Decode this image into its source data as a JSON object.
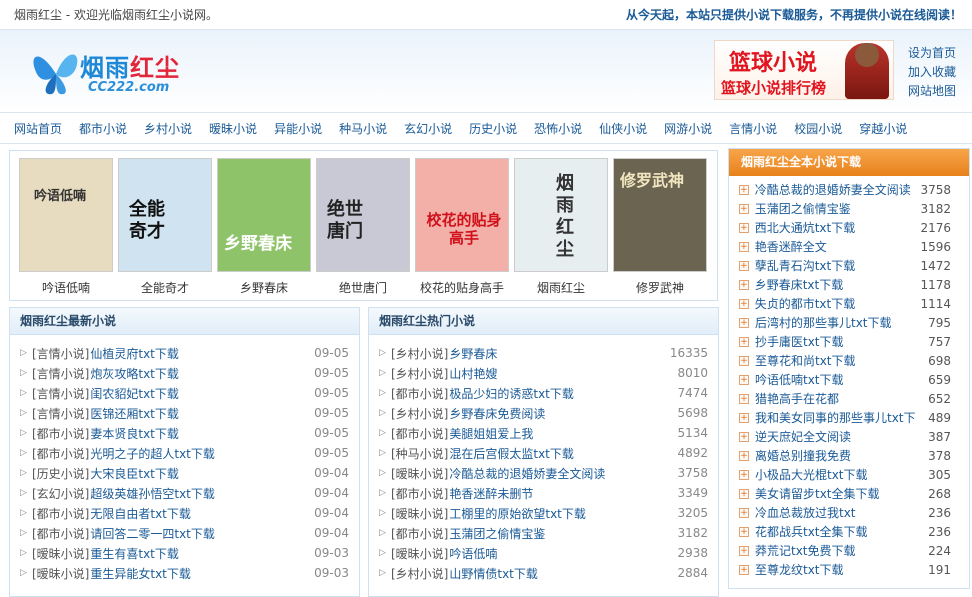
{
  "topbar": {
    "welcome": "烟雨红尘 - 欢迎光临烟雨红尘小说网。",
    "notice": "从今天起，本站只提供小说下载服务，不再提供小说在线阅读！"
  },
  "logo": {
    "title_blue": "烟雨",
    "title_red": "红尘",
    "domain": "CC222.com"
  },
  "banner": {
    "title": "篮球小说",
    "subtitle": "篮球小说排行榜"
  },
  "header_links": [
    "设为首页",
    "加入收藏",
    "网站地图"
  ],
  "nav": [
    "网站首页",
    "都市小说",
    "乡村小说",
    "暧昧小说",
    "异能小说",
    "种马小说",
    "玄幻小说",
    "历史小说",
    "恐怖小说",
    "仙侠小说",
    "网游小说",
    "言情小说",
    "校园小说",
    "穿越小说"
  ],
  "covers": [
    {
      "name": "吟语低喃",
      "cover_text": "吟语低喃",
      "bg": "#e8dcc0",
      "fg": "#333333"
    },
    {
      "name": "全能奇才",
      "cover_text": "全能奇才",
      "bg": "#cfe3f0",
      "fg": "#111111"
    },
    {
      "name": "乡野春床",
      "cover_text": "乡野春床",
      "bg": "#8fc36a",
      "fg": "#ffffff"
    },
    {
      "name": "绝世唐门",
      "cover_text": "绝世唐门",
      "bg": "#c9c9d6",
      "fg": "#222222"
    },
    {
      "name": "校花的贴身高手",
      "cover_text": "校花的贴身高手",
      "bg": "#f2b0a8",
      "fg": "#d0101a"
    },
    {
      "name": "烟雨红尘",
      "cover_text": "烟雨红尘",
      "bg": "#e6eef0",
      "fg": "#333333"
    },
    {
      "name": "修罗武神",
      "cover_text": "修罗武神",
      "bg": "#6b6450",
      "fg": "#f0e6c0"
    }
  ],
  "latest": {
    "heading": "烟雨红尘最新小说",
    "rows": [
      {
        "cat": "[言情小说]",
        "title": "仙植灵府txt下载",
        "val": "09-05"
      },
      {
        "cat": "[言情小说]",
        "title": "炮灰攻略txt下载",
        "val": "09-05"
      },
      {
        "cat": "[言情小说]",
        "title": "闺农貂妃txt下载",
        "val": "09-05"
      },
      {
        "cat": "[言情小说]",
        "title": "医锦还厢txt下载",
        "val": "09-05"
      },
      {
        "cat": "[都市小说]",
        "title": "妻本贤良txt下载",
        "val": "09-05"
      },
      {
        "cat": "[都市小说]",
        "title": "光明之子的超人txt下载",
        "val": "09-05"
      },
      {
        "cat": "[历史小说]",
        "title": "大宋良臣txt下载",
        "val": "09-04"
      },
      {
        "cat": "[玄幻小说]",
        "title": "超级英雄孙悟空txt下载",
        "val": "09-04"
      },
      {
        "cat": "[都市小说]",
        "title": "无限自由者txt下载",
        "val": "09-04"
      },
      {
        "cat": "[都市小说]",
        "title": "请回答二零一四txt下载",
        "val": "09-04"
      },
      {
        "cat": "[暧昧小说]",
        "title": "重生有喜txt下载",
        "val": "09-03"
      },
      {
        "cat": "[暧昧小说]",
        "title": "重生异能女txt下载",
        "val": "09-03"
      }
    ]
  },
  "hot": {
    "heading": "烟雨红尘热门小说",
    "rows": [
      {
        "cat": "[乡村小说]",
        "title": "乡野春床",
        "val": "16335"
      },
      {
        "cat": "[乡村小说]",
        "title": "山村艳嫂",
        "val": "8010"
      },
      {
        "cat": "[都市小说]",
        "title": "极品少妇的诱惑txt下载",
        "val": "7474"
      },
      {
        "cat": "[乡村小说]",
        "title": "乡野春床免费阅读",
        "val": "5698"
      },
      {
        "cat": "[都市小说]",
        "title": "美腿姐姐爱上我",
        "val": "5134"
      },
      {
        "cat": "[种马小说]",
        "title": "混在后宫假太监txt下载",
        "val": "4892"
      },
      {
        "cat": "[暧昧小说]",
        "title": "冷酷总裁的退婚娇妻全文阅读",
        "val": "3758"
      },
      {
        "cat": "[都市小说]",
        "title": "艳香迷醉未删节",
        "val": "3349"
      },
      {
        "cat": "[暧昧小说]",
        "title": "工棚里的原始欲望txt下载",
        "val": "3205"
      },
      {
        "cat": "[都市小说]",
        "title": "玉蒲团之偷情宝鉴",
        "val": "3182"
      },
      {
        "cat": "[暧昧小说]",
        "title": "吟语低喃",
        "val": "2938"
      },
      {
        "cat": "[乡村小说]",
        "title": "山野情债txt下载",
        "val": "2884"
      }
    ]
  },
  "sidebar": {
    "heading": "烟雨红尘全本小说下载",
    "rows": [
      {
        "title": "冷酷总裁的退婚娇妻全文阅读",
        "val": "3758"
      },
      {
        "title": "玉蒲团之偷情宝鉴",
        "val": "3182"
      },
      {
        "title": "西北大通炕txt下载",
        "val": "2176"
      },
      {
        "title": "艳香迷醉全文",
        "val": "1596"
      },
      {
        "title": "孽乱青石沟txt下载",
        "val": "1472"
      },
      {
        "title": "乡野春床txt下载",
        "val": "1178"
      },
      {
        "title": "失贞的都市txt下载",
        "val": "1114"
      },
      {
        "title": "后湾村的那些事儿txt下载",
        "val": "795"
      },
      {
        "title": "抄手庸医txt下载",
        "val": "757"
      },
      {
        "title": "至尊花和尚txt下载",
        "val": "698"
      },
      {
        "title": "吟语低喃txt下载",
        "val": "659"
      },
      {
        "title": "猎艳高手在花都",
        "val": "652"
      },
      {
        "title": "我和美女同事的那些事儿txt下",
        "val": "489"
      },
      {
        "title": "逆天庶妃全文阅读",
        "val": "387"
      },
      {
        "title": "离婚总别撞我免费",
        "val": "378"
      },
      {
        "title": "小极品大光棍txt下载",
        "val": "305"
      },
      {
        "title": "美女请留步txt全集下载",
        "val": "268"
      },
      {
        "title": "冷血总裁放过我txt",
        "val": "236"
      },
      {
        "title": "花都战兵txt全集下载",
        "val": "236"
      },
      {
        "title": "莽荒记txt免费下载",
        "val": "224"
      },
      {
        "title": "至尊龙纹txt下载",
        "val": "191"
      }
    ]
  }
}
